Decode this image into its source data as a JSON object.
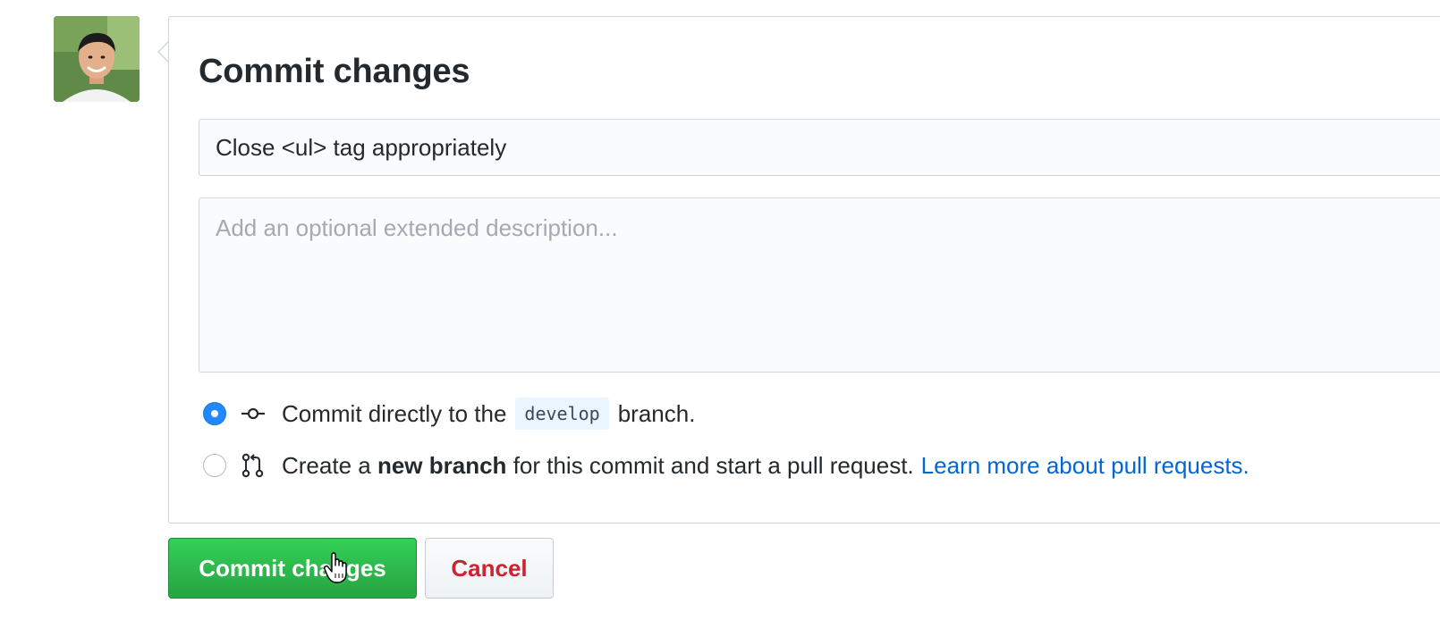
{
  "form": {
    "title": "Commit changes",
    "summary_value": "Close <ul> tag appropriately",
    "description_placeholder": "Add an optional extended description..."
  },
  "options": [
    {
      "checked": true,
      "icon": "git-commit-icon",
      "text_before": "Commit directly to the",
      "branch": "develop",
      "text_after": "branch."
    },
    {
      "checked": false,
      "icon": "git-pull-request-icon",
      "text_before": "Create a",
      "bold": "new branch",
      "text_after": "for this commit and start a pull request.",
      "link": "Learn more about pull requests."
    }
  ],
  "buttons": {
    "commit_label": "Commit changes",
    "cancel_label": "Cancel"
  },
  "colors": {
    "primary_green": "#28a745",
    "danger_red": "#cb2431",
    "link_blue": "#0366d6",
    "radio_blue": "#2188ff"
  }
}
